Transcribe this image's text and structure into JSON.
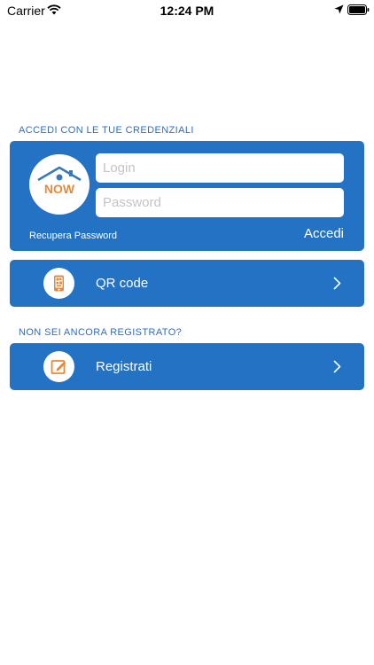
{
  "status_bar": {
    "carrier": "Carrier",
    "time": "12:24 PM"
  },
  "login_section": {
    "heading": "ACCEDI CON LE TUE CREDENZIALI",
    "logo_text": "NOW",
    "login_placeholder": "Login",
    "password_placeholder": "Password",
    "recover_password": "Recupera Password",
    "submit_label": "Accedi"
  },
  "qr_row": {
    "label": "QR code",
    "icon": "qr-phone-icon"
  },
  "register_section": {
    "heading": "NON SEI ANCORA REGISTRATO?",
    "label": "Registrati",
    "icon": "edit-note-icon"
  },
  "colors": {
    "card_blue": "#2472c3",
    "heading_blue": "#2a6fc0",
    "icon_orange": "#e8893a",
    "logo_blue": "#3b78b8"
  }
}
